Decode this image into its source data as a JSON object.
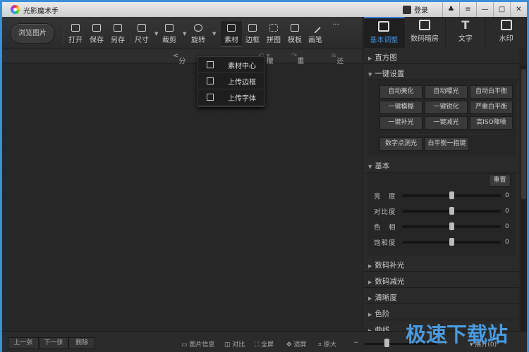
{
  "app": {
    "title": "光影魔术手",
    "login": "登录",
    "window_buttons": [
      "♣",
      "≡",
      "—",
      "□",
      "✕"
    ]
  },
  "toolbar": {
    "browse": "浏览图片",
    "tools": [
      "打开",
      "保存",
      "另存",
      "尺寸",
      "裁剪",
      "旋转",
      "素材",
      "边框",
      "拼图",
      "模板",
      "画笔"
    ],
    "more": "···"
  },
  "subbar": {
    "share": "分享",
    "undo": "撤销",
    "redo": "重做",
    "restore": "还原"
  },
  "dropdown": [
    "素材中心",
    "上传边框",
    "上传字体"
  ],
  "right_tabs": [
    "基本调整",
    "数码暗房",
    "文字",
    "水印"
  ],
  "panel": {
    "histogram": "直方图",
    "one_click": "一键设置",
    "one_click_buttons": [
      [
        "自动美化",
        "自动曝光",
        "自动白平衡"
      ],
      [
        "一键模糊",
        "一键锐化",
        "严重白平衡"
      ],
      [
        "一键补光",
        "一键减光",
        "高ISO降噪"
      ]
    ],
    "extra_buttons": [
      "数字点测光",
      "白平衡一指键"
    ],
    "basic": "基本",
    "reset": "重置",
    "sliders": [
      {
        "label": "亮　度",
        "value": "0",
        "fraction": 0.5
      },
      {
        "label": "对比度",
        "value": "0",
        "fraction": 0.5
      },
      {
        "label": "色　相",
        "value": "0",
        "fraction": 0.5
      },
      {
        "label": "饱和度",
        "value": "0",
        "fraction": 0.5
      }
    ],
    "collapsed": [
      "数码补光",
      "数码减光",
      "清晰度",
      "色阶",
      "曲线"
    ]
  },
  "bottom": {
    "prev": "上一张",
    "next": "下一张",
    "delete": "删除",
    "info": "图片信息",
    "compare": "对比",
    "fullscreen": "全屏",
    "fit": "适屏",
    "original": "原大",
    "minus": "−",
    "plus": "+",
    "expand": "▾ 展开(0)",
    "zoom_fraction": 0.3
  },
  "watermark": "极速下载站"
}
